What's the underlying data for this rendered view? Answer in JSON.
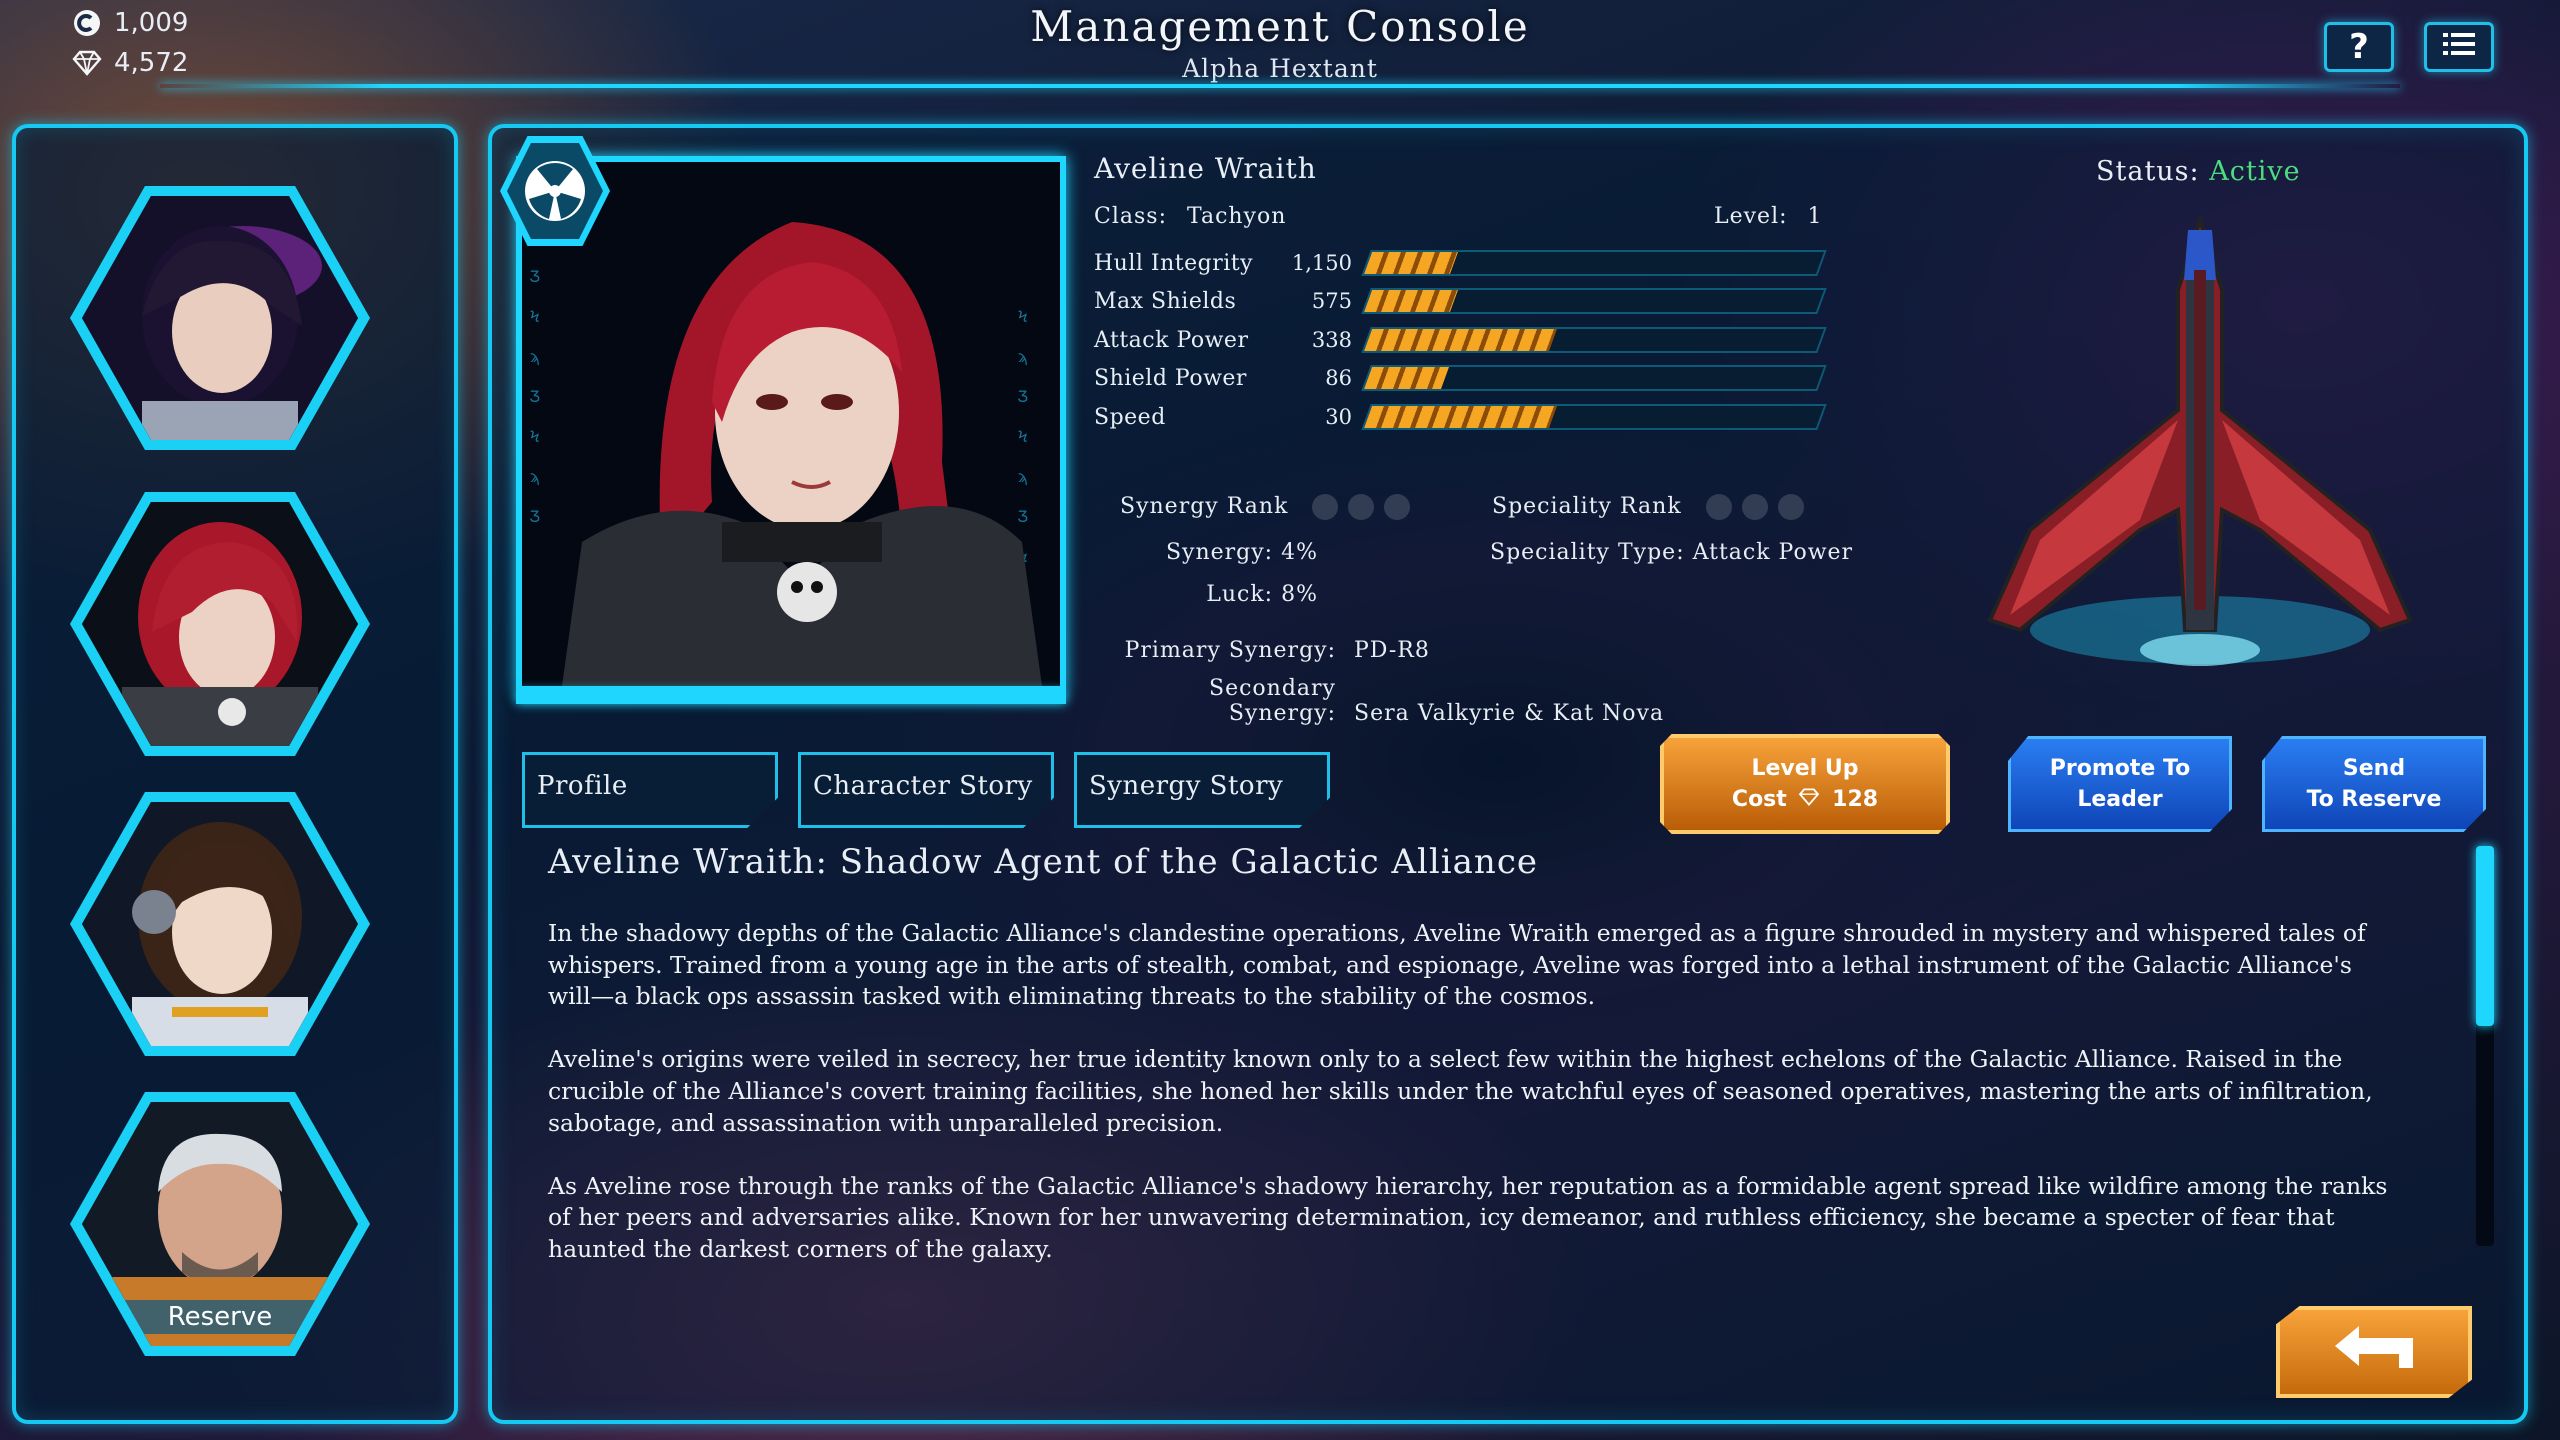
{
  "header": {
    "title": "Management Console",
    "subtitle": "Alpha Hextant",
    "credits": "1,009",
    "gems": "4,572"
  },
  "roster": [
    {
      "name": "roster-slot-1"
    },
    {
      "name": "roster-slot-2"
    },
    {
      "name": "roster-slot-3"
    },
    {
      "name": "roster-slot-4",
      "label": "Reserve"
    }
  ],
  "character": {
    "name": "Aveline Wraith",
    "class_label": "Class:",
    "class_value": "Tachyon",
    "level_label": "Level:",
    "level_value": "1",
    "status_label": "Status:",
    "status_value": "Active",
    "stats": [
      {
        "label": "Hull Integrity",
        "value": "1,150",
        "fraction": 0.19
      },
      {
        "label": "Max Shields",
        "value": "575",
        "fraction": 0.19
      },
      {
        "label": "Attack Power",
        "value": "338",
        "fraction": 0.41
      },
      {
        "label": "Shield Power",
        "value": "86",
        "fraction": 0.17
      },
      {
        "label": "Speed",
        "value": "30",
        "fraction": 0.41
      }
    ],
    "synergy_rank_label": "Synergy Rank",
    "synergy_rank_filled": 0,
    "speciality_rank_label": "Speciality Rank",
    "speciality_rank_filled": 0,
    "synergy_label": "Synergy:",
    "synergy_value": "4%",
    "luck_label": "Luck:",
    "luck_value": "8%",
    "speciality_type_label": "Speciality Type:",
    "speciality_type_value": "Attack Power",
    "primary_synergy_label": "Primary Synergy:",
    "primary_synergy_value": "PD-R8",
    "secondary_synergy_label": "Secondary Synergy:",
    "secondary_synergy_value": "Sera Valkyrie & Kat Nova"
  },
  "tabs": [
    "Profile",
    "Character Story",
    "Synergy Story"
  ],
  "actions": {
    "level_up_line1": "Level Up",
    "level_up_cost_label": "Cost",
    "level_up_cost_value": "128",
    "promote_line1": "Promote To",
    "promote_line2": "Leader",
    "reserve_line1": "Send",
    "reserve_line2": "To Reserve"
  },
  "story": {
    "title": "Aveline Wraith: Shadow Agent of the Galactic Alliance",
    "paragraphs": [
      "In the shadowy depths of the Galactic Alliance's clandestine operations, Aveline Wraith emerged as a figure shrouded in mystery and whispered tales of whispers. Trained from a young age in the arts of stealth, combat, and espionage, Aveline was forged into a lethal instrument of the Galactic Alliance's will—a black ops assassin tasked with eliminating threats to the stability of the cosmos.",
      "Aveline's origins were veiled in secrecy, her true identity known only to a select few within the highest echelons of the Galactic Alliance. Raised in the crucible of the Alliance's covert training facilities, she honed her skills under the watchful eyes of seasoned operatives, mastering the arts of infiltration, sabotage, and assassination with unparalleled precision.",
      "As Aveline rose through the ranks of the Galactic Alliance's shadowy hierarchy, her reputation as a formidable agent spread like wildfire among the ranks of her peers and adversaries alike. Known for her unwavering determination, icy demeanor, and ruthless efficiency, she became a specter of fear that haunted the darkest corners of the galaxy."
    ]
  },
  "colors": {
    "accent": "#1fd6ff",
    "status_active": "#4ade80",
    "bar_fill": "#f5a623",
    "button_orange": "#f59b2c",
    "button_blue": "#2a7ef2"
  },
  "icons": {
    "credits": "credits-coin-icon",
    "gems": "gem-icon",
    "help": "help-icon",
    "menu": "menu-list-icon",
    "emblem": "faction-emblem-icon",
    "back": "back-arrow-icon"
  }
}
